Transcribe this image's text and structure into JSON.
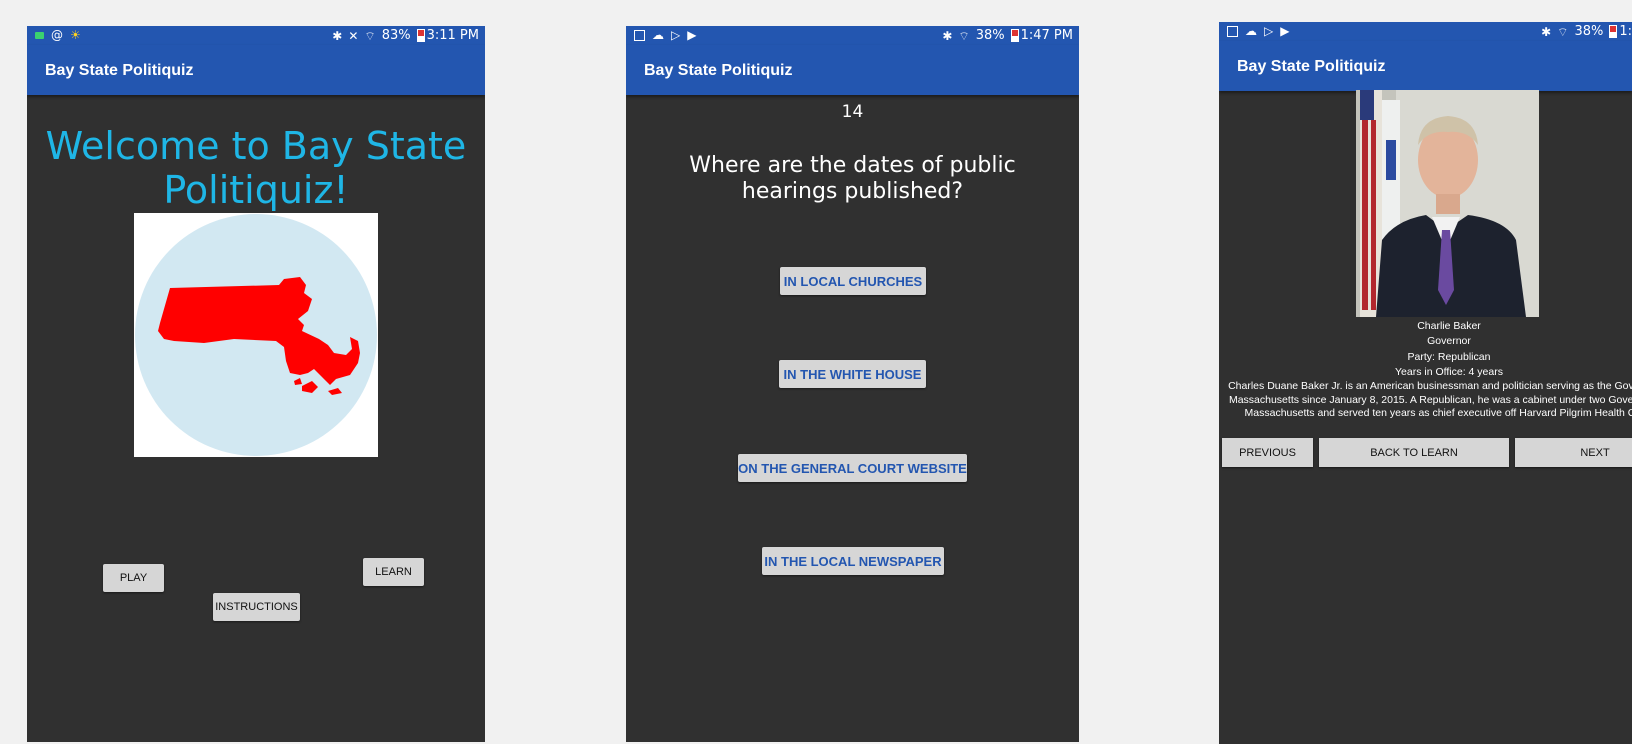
{
  "screens": [
    {
      "status": {
        "battery": "83%",
        "time": "3:11 PM"
      },
      "app_title": "Bay State Politiquiz",
      "welcome": "Welcome to Bay State Politiquiz!",
      "buttons": {
        "play": "PLAY",
        "learn": "LEARN",
        "instructions": "INSTRUCTIONS"
      }
    },
    {
      "status": {
        "battery": "38%",
        "time": "1:47 PM"
      },
      "app_title": "Bay State Politiquiz",
      "question_number": "14",
      "question": "Where are the dates of public hearings published?",
      "answers": [
        "IN LOCAL CHURCHES",
        "IN THE WHITE HOUSE",
        "ON THE GENERAL COURT WEBSITE",
        "IN THE LOCAL NEWSPAPER"
      ]
    },
    {
      "status": {
        "battery": "38%",
        "time": "1:"
      },
      "app_title": "Bay State Politiquiz",
      "person": {
        "name": "Charlie Baker",
        "position": "Governor",
        "party": "Party: Republican",
        "years": "Years in Office: 4 years",
        "bio": "Charles Duane Baker Jr. is an American businessman and politician serving as the Governor of Massachusetts since January 8, 2015. A Republican, he was a cabinet under two Governors of Massachusetts and served ten years as chief executive off Harvard Pilgrim Health Care."
      },
      "nav": {
        "previous": "PREVIOUS",
        "back": "BACK TO LEARN",
        "next": "NEXT"
      }
    }
  ],
  "colors": {
    "primary": "#2356b0",
    "background": "#303030",
    "accent_title": "#1fb6e6",
    "map": "#ff0000",
    "map_circle": "#d2e8f2"
  }
}
